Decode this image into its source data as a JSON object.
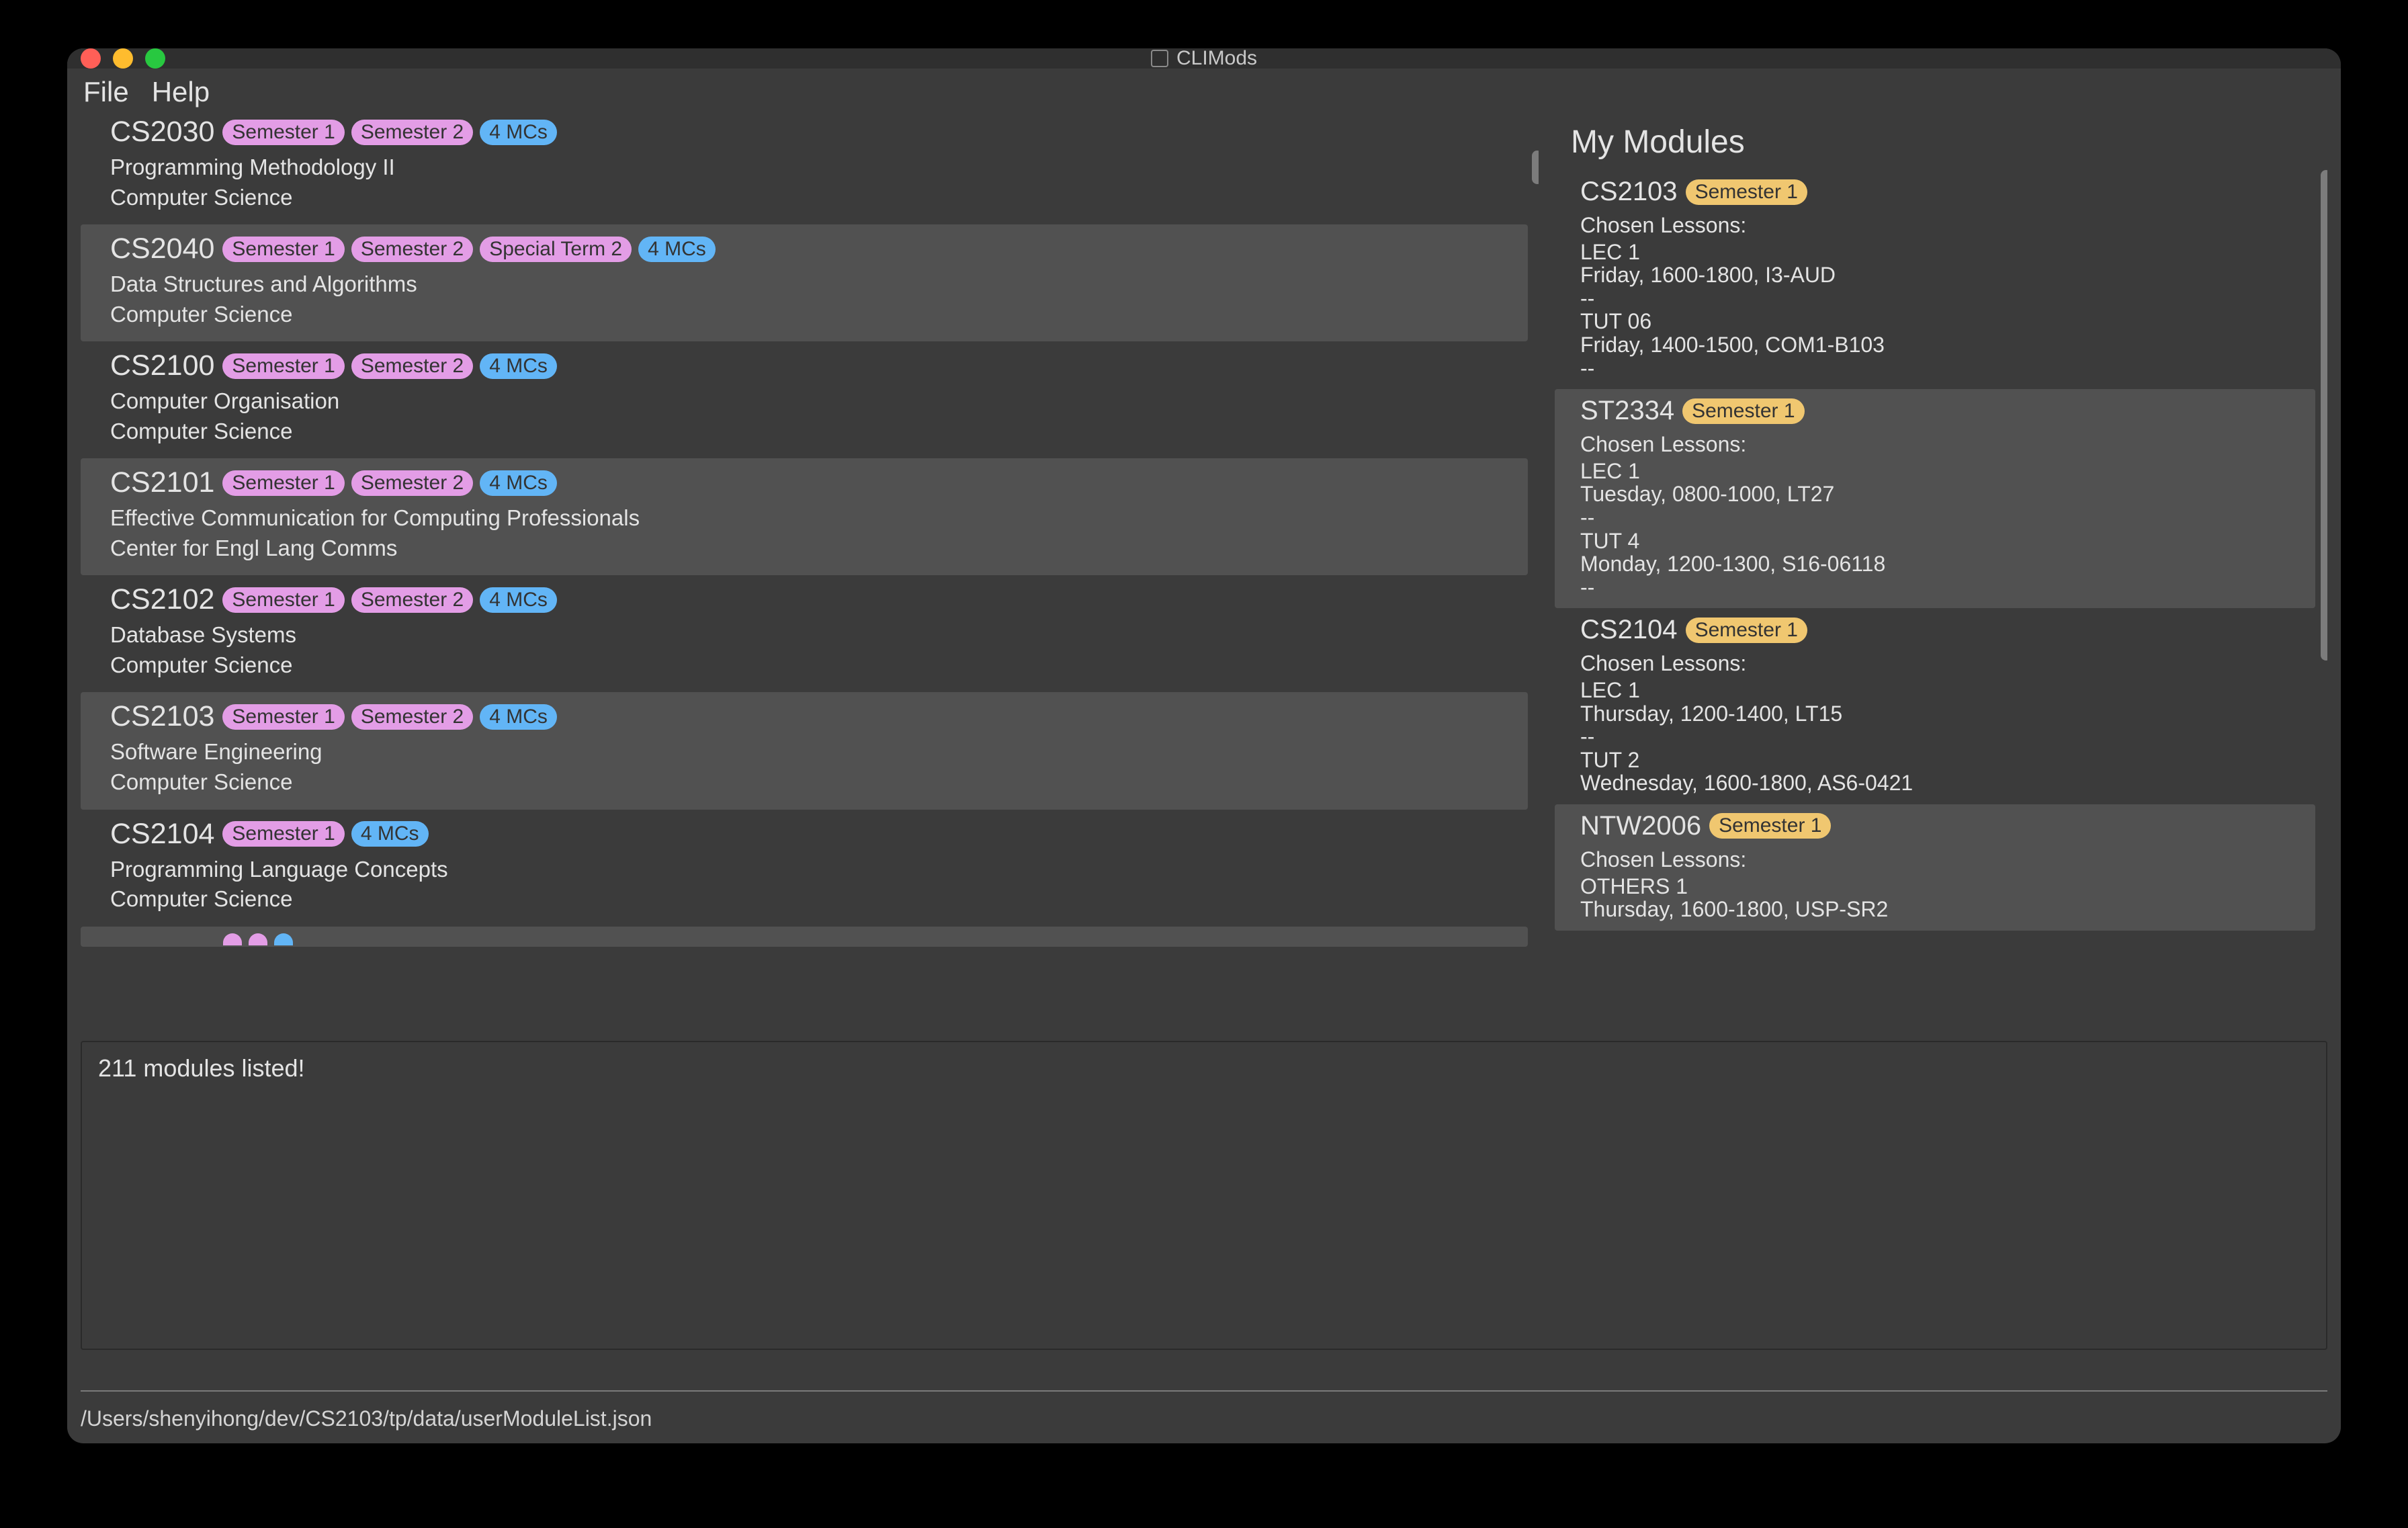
{
  "app": {
    "title": "CLIMods"
  },
  "menu": {
    "file": "File",
    "help": "Help"
  },
  "modules": [
    {
      "code": "CS2030",
      "sems": [
        "Semester 1",
        "Semester 2"
      ],
      "mc": "4 MCs",
      "title": "Programming Methodology II",
      "dept": "Computer Science",
      "alt": false,
      "topcut": true
    },
    {
      "code": "CS2040",
      "sems": [
        "Semester 1",
        "Semester 2",
        "Special Term 2"
      ],
      "mc": "4 MCs",
      "title": "Data Structures and Algorithms",
      "dept": "Computer Science",
      "alt": true
    },
    {
      "code": "CS2100",
      "sems": [
        "Semester 1",
        "Semester 2"
      ],
      "mc": "4 MCs",
      "title": "Computer Organisation",
      "dept": "Computer Science",
      "alt": false
    },
    {
      "code": "CS2101",
      "sems": [
        "Semester 1",
        "Semester 2"
      ],
      "mc": "4 MCs",
      "title": "Effective Communication for Computing Professionals",
      "dept": "Center for Engl Lang Comms",
      "alt": true
    },
    {
      "code": "CS2102",
      "sems": [
        "Semester 1",
        "Semester 2"
      ],
      "mc": "4 MCs",
      "title": "Database Systems",
      "dept": "Computer Science",
      "alt": false
    },
    {
      "code": "CS2103",
      "sems": [
        "Semester 1",
        "Semester 2"
      ],
      "mc": "4 MCs",
      "title": "Software Engineering",
      "dept": "Computer Science",
      "alt": true
    },
    {
      "code": "CS2104",
      "sems": [
        "Semester 1"
      ],
      "mc": "4 MCs",
      "title": "Programming Language Concepts",
      "dept": "Computer Science",
      "alt": false
    }
  ],
  "right": {
    "title": "My Modules",
    "items": [
      {
        "code": "CS2103",
        "sem": "Semester 1",
        "chosen": "Chosen Lessons:",
        "lines": [
          "LEC 1",
          "Friday, 1600-1800, I3-AUD",
          "--",
          "TUT 06",
          "Friday, 1400-1500, COM1-B103",
          "--"
        ],
        "alt": false
      },
      {
        "code": "ST2334",
        "sem": "Semester 1",
        "chosen": "Chosen Lessons:",
        "lines": [
          "LEC 1",
          "Tuesday, 0800-1000, LT27",
          "--",
          "TUT 4",
          "Monday, 1200-1300, S16-06118",
          "--"
        ],
        "alt": true
      },
      {
        "code": "CS2104",
        "sem": "Semester 1",
        "chosen": "Chosen Lessons:",
        "lines": [
          "LEC 1",
          "Thursday, 1200-1400, LT15",
          "--",
          "TUT 2",
          "Wednesday, 1600-1800, AS6-0421"
        ],
        "alt": false
      },
      {
        "code": "NTW2006",
        "sem": "Semester 1",
        "chosen": "Chosen Lessons:",
        "lines": [
          "OTHERS 1",
          "Thursday, 1600-1800, USP-SR2"
        ],
        "alt": true
      }
    ]
  },
  "output": {
    "text": "211 modules listed!"
  },
  "status": {
    "path": "/Users/shenyihong/dev/CS2103/tp/data/userModuleList.json"
  }
}
